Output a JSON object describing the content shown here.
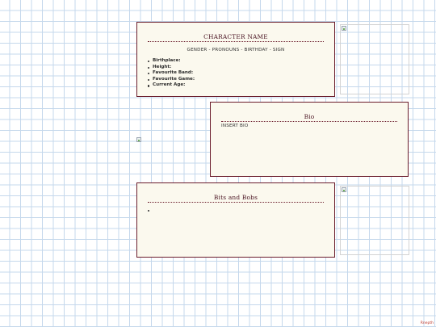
{
  "profile": {
    "name": "CHARACTER NAME",
    "meta": "GENDER - PRONOUNS - BIRTHDAY - SIGN",
    "facts": [
      "Birthplace:",
      "Height:",
      "Favourite Band:",
      "Favourite Game:",
      "Current Age:"
    ]
  },
  "bio": {
    "title": "Bio",
    "text": "INSERT BIO"
  },
  "bits": {
    "title": "Bits and Bobs",
    "items": [
      ""
    ]
  },
  "credit": "Rnepth"
}
